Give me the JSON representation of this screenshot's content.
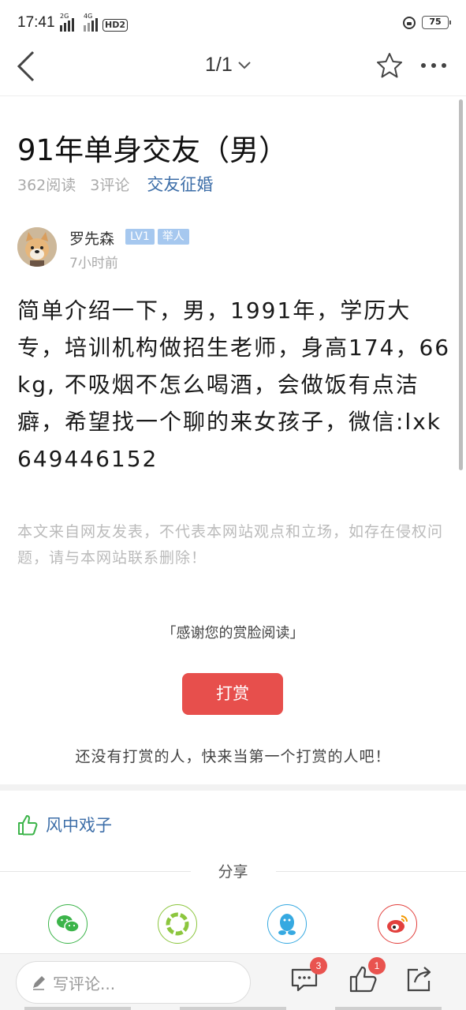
{
  "status": {
    "time": "17:41",
    "sim1": "2G",
    "sim2": "4G",
    "hd": "HD2",
    "battery": "75"
  },
  "nav": {
    "page_indicator": "1/1"
  },
  "article": {
    "title": "91年单身交友（男）",
    "reads": "362阅读",
    "comments": "3评论",
    "category": "交友征婚",
    "author": {
      "name": "罗先森",
      "level": "LV1",
      "role": "举人",
      "time": "7小时前"
    },
    "body": "简单介绍一下，男，1991年，学历大专，培训机构做招生老师，身高174，66kg, 不吸烟不怎么喝酒，会做饭有点洁癖，希望找一个聊的来女孩子，微信:lxk649446152",
    "disclaimer": "本文来自网友发表，不代表本网站观点和立场，如存在侵权问题，请与本网站联系删除！"
  },
  "reward": {
    "thanks": "「感谢您的赏脸阅读」",
    "button": "打赏",
    "note": "还没有打赏的人，快来当第一个打赏的人吧！"
  },
  "likes": {
    "user": "风中戏子"
  },
  "share": {
    "title": "分享",
    "targets": [
      "wechat-icon",
      "moments-icon",
      "qq-icon",
      "weibo-icon"
    ],
    "colors": {
      "wechat": "#3cb44a",
      "moments": "#8cc63e",
      "qq": "#36a9e1",
      "weibo": "#e2403d"
    }
  },
  "bottom": {
    "comment_placeholder": "写评论...",
    "comment_count": "3",
    "like_count": "1"
  }
}
